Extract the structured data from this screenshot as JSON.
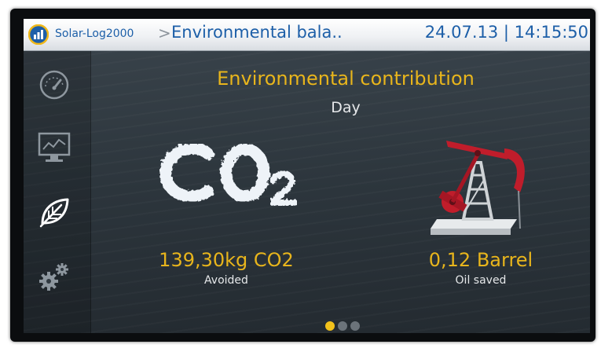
{
  "header": {
    "app_name": "Solar-Log2000",
    "separator": ">",
    "page_title": "Environmental bala..",
    "datetime": "24.07.13 | 14:15:50"
  },
  "sidebar": {
    "items": [
      {
        "name": "dashboard",
        "icon": "gauge-icon",
        "active": false
      },
      {
        "name": "yield-chart",
        "icon": "monitor-chart-icon",
        "active": false
      },
      {
        "name": "environment",
        "icon": "leaf-icon",
        "active": true
      },
      {
        "name": "settings",
        "icon": "gears-icon",
        "active": false
      }
    ]
  },
  "main": {
    "title": "Environmental contribution",
    "period": "Day",
    "co2": {
      "value": "139,30kg CO2",
      "label": "Avoided"
    },
    "oil": {
      "value": "0,12 Barrel",
      "label": "Oil saved"
    }
  },
  "pagination": {
    "total": 3,
    "current": 1
  },
  "colors": {
    "accent": "#e8b51c",
    "title_blue": "#1d5fa8",
    "text": "#e6e8ea",
    "icon_inactive": "#8e979f",
    "icon_active": "#ffffff",
    "dot_active": "#f2c21b",
    "dot_inactive": "#6b737a"
  }
}
